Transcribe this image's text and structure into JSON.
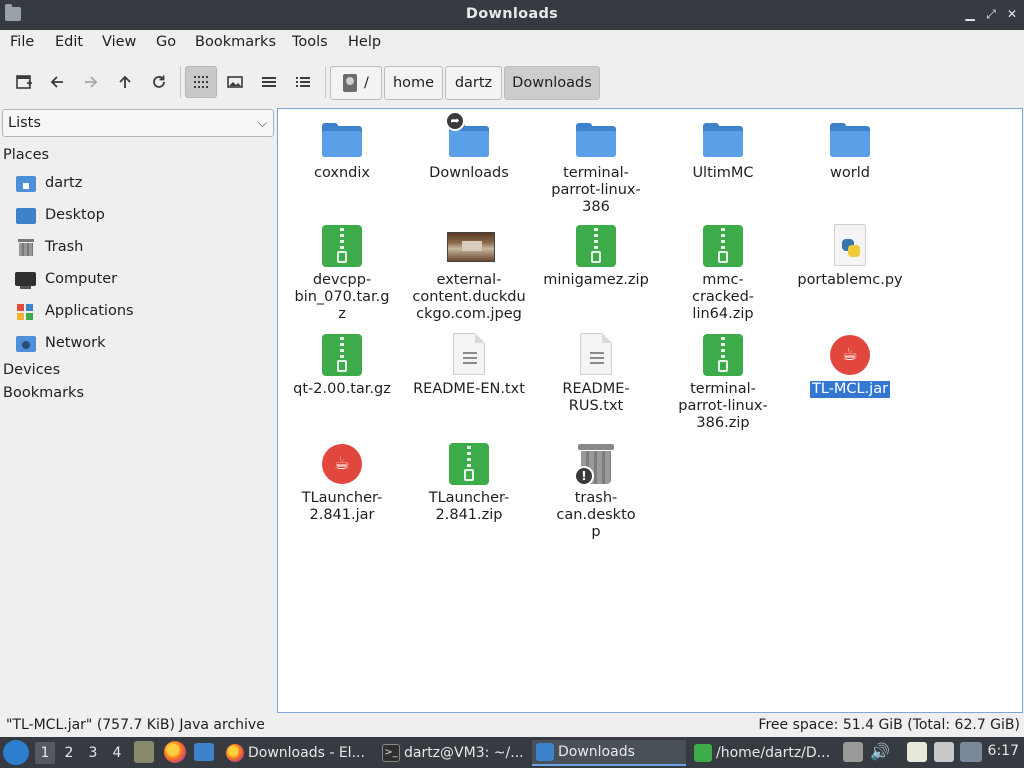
{
  "window": {
    "title": "Downloads"
  },
  "menubar": [
    "File",
    "Edit",
    "View",
    "Go",
    "Bookmarks",
    "Tools",
    "Help"
  ],
  "breadcrumb": {
    "root": "/",
    "items": [
      "home",
      "dartz",
      "Downloads"
    ]
  },
  "sidebar": {
    "selector": "Lists",
    "places_header": "Places",
    "places": [
      "dartz",
      "Desktop",
      "Trash",
      "Computer",
      "Applications",
      "Network"
    ],
    "devices_header": "Devices",
    "bookmarks_header": "Bookmarks"
  },
  "files": [
    {
      "name": "coxndix",
      "type": "folder"
    },
    {
      "name": "Downloads",
      "type": "folder-link"
    },
    {
      "name": "terminal-parrot-linux-386",
      "type": "folder"
    },
    {
      "name": "UltimMC",
      "type": "folder"
    },
    {
      "name": "world",
      "type": "folder"
    },
    {
      "name": "devcpp-bin_070.tar.gz",
      "type": "archive"
    },
    {
      "name": "external-content.duckduckgo.com.jpeg",
      "type": "image"
    },
    {
      "name": "minigamez.zip",
      "type": "archive"
    },
    {
      "name": "mmc-cracked-lin64.zip",
      "type": "archive"
    },
    {
      "name": "portablemc.py",
      "type": "python"
    },
    {
      "name": "qt-2.00.tar.gz",
      "type": "archive"
    },
    {
      "name": "README-EN.txt",
      "type": "text"
    },
    {
      "name": "README-RUS.txt",
      "type": "text"
    },
    {
      "name": "terminal-parrot-linux-386.zip",
      "type": "archive"
    },
    {
      "name": "TL-MCL.jar",
      "type": "java",
      "selected": true
    },
    {
      "name": "TLauncher-2.841.jar",
      "type": "java"
    },
    {
      "name": "TLauncher-2.841.zip",
      "type": "archive"
    },
    {
      "name": "trash-can.desktop",
      "type": "desktop"
    }
  ],
  "status": {
    "left": "\"TL-MCL.jar\" (757.7 KiB) Java archive",
    "right": "Free space: 51.4 GiB (Total: 62.7 GiB)"
  },
  "taskbar": {
    "workspaces": [
      "1",
      "2",
      "3",
      "4"
    ],
    "apps": [
      {
        "label": "Downloads - El...",
        "icon": "firefox-icon"
      },
      {
        "label": "dartz@VM3: ~/...",
        "icon": "terminal-icon"
      },
      {
        "label": "Downloads",
        "icon": "folder-icon",
        "active": true
      },
      {
        "label": "/home/dartz/D...",
        "icon": "archive-icon"
      }
    ],
    "clock": "6:17"
  },
  "colors": {
    "selection": "#3477d3",
    "titlebar": "#363a41",
    "folder": "#5aa0e8",
    "archive": "#3dab4a",
    "java": "#e1473c"
  }
}
